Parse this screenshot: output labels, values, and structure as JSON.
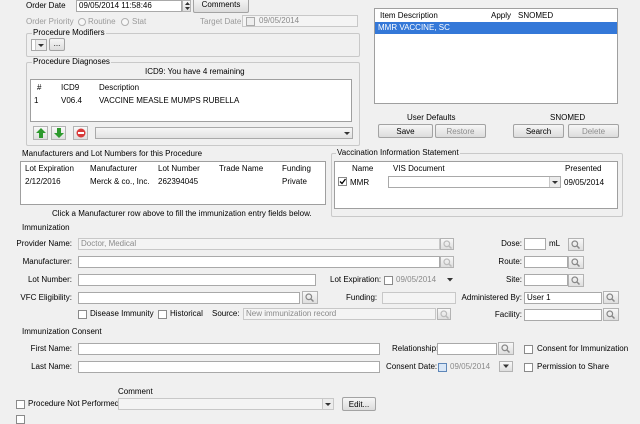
{
  "order": {
    "order_date_label": "Order Date",
    "order_date_value": "09/05/2014 11:58:46",
    "comments_label": "Comments",
    "order_priority_label": "Order Priority",
    "routine_label": "Routine",
    "stat_label": "Stat",
    "target_date_label": "Target Date",
    "target_date_value": "09/05/2014"
  },
  "modifiers": {
    "title": "Procedure Modifiers",
    "more_label": "..."
  },
  "diagnoses": {
    "title": "Procedure Diagnoses",
    "status": "ICD9: You have 4 remaining",
    "columns": [
      "#",
      "ICD9",
      "Description"
    ],
    "rows": [
      {
        "num": "1",
        "code": "V06.4",
        "description": "VACCINE MEASLE MUMPS RUBELLA"
      }
    ]
  },
  "procedure_list": {
    "columns": [
      "Item Description",
      "Apply",
      "SNOMED"
    ],
    "selected_item": "MMR VACCINE, SC"
  },
  "user_defaults": {
    "title": "User Defaults",
    "save": "Save",
    "restore": "Restore"
  },
  "snomed": {
    "title": "SNOMED",
    "search": "Search",
    "delete": "Delete"
  },
  "manufacturers": {
    "title": "Manufacturers and Lot Numbers for this Procedure",
    "columns": [
      "Lot Expiration",
      "Manufacturer",
      "Lot Number",
      "Trade Name",
      "Funding"
    ],
    "rows": [
      {
        "expiration": "2/12/2016",
        "manufacturer": "Merck & co., Inc.",
        "lot": "262394045",
        "trade": "",
        "funding": "Private"
      }
    ],
    "hint": "Click a Manufacturer row above to fill the immunization entry fields below."
  },
  "vis": {
    "title": "Vaccination Information Statement",
    "columns": [
      "Name",
      "VIS Document",
      "Presented"
    ],
    "row": {
      "name": "MMR",
      "document": "",
      "presented": "09/05/2014"
    }
  },
  "immunization": {
    "title": "Immunization",
    "provider_label": "Provider Name:",
    "provider_value": "Doctor, Medical",
    "manufacturer_label": "Manufacturer:",
    "lot_label": "Lot Number:",
    "lot_expiration_label": "Lot Expiration:",
    "lot_expiration_value": "09/05/2014",
    "vfc_label": "VFC Eligibility:",
    "funding_label": "Funding:",
    "disease_immunity_label": "Disease Immunity",
    "historical_label": "Historical",
    "source_label": "Source:",
    "source_value": "New immunization record",
    "dose_label": "Dose:",
    "dose_unit": "mL",
    "route_label": "Route:",
    "site_label": "Site:",
    "administered_label": "Administered By:",
    "administered_value": "User 1",
    "facility_label": "Facility:"
  },
  "consent": {
    "title": "Immunization Consent",
    "first_name_label": "First Name:",
    "last_name_label": "Last Name:",
    "relationship_label": "Relationship:",
    "consent_date_label": "Consent Date:",
    "consent_date_value": "09/05/2014",
    "consent_for_immunization_label": "Consent for Immunization",
    "permission_to_share_label": "Permission to Share"
  },
  "footer": {
    "comment_label": "Comment",
    "procedure_not_performed_label": "Procedure Not Performed",
    "edit_label": "Edit..."
  }
}
